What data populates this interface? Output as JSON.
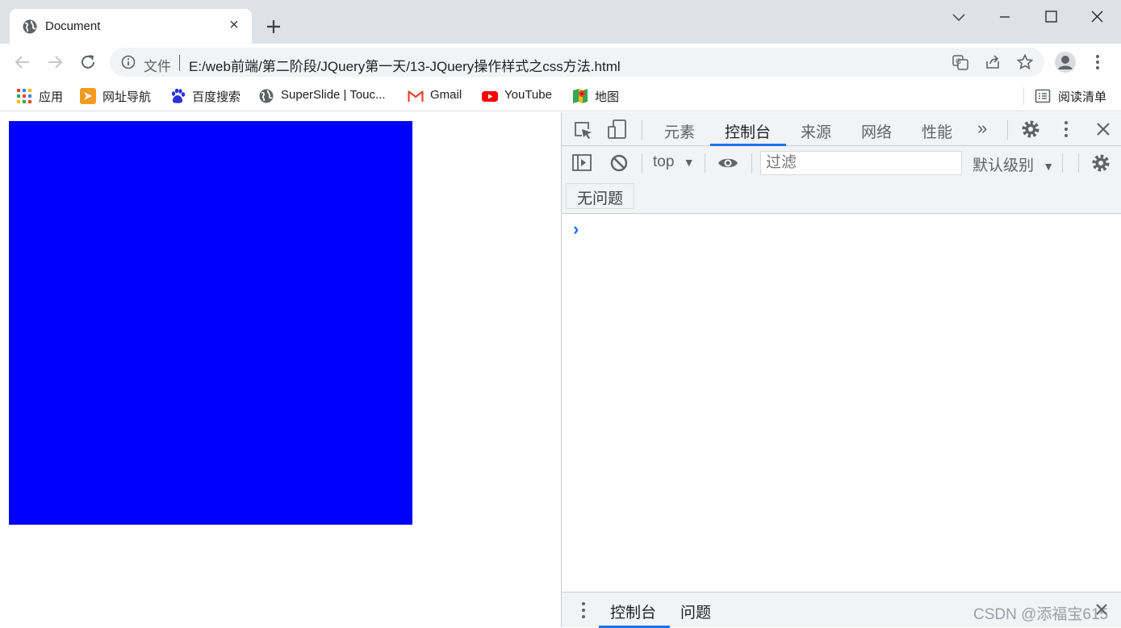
{
  "browser": {
    "tab": {
      "title": "Document"
    },
    "address_bar": {
      "security_label": "文件",
      "url": "E:/web前端/第二阶段/JQuery第一天/13-JQuery操作样式之css方法.html"
    },
    "bookmarks": [
      {
        "label": "应用",
        "icon": "apps-grid-icon"
      },
      {
        "label": "网址导航",
        "icon": "nav-arrow-icon"
      },
      {
        "label": "百度搜索",
        "icon": "baidu-paw-icon"
      },
      {
        "label": "SuperSlide | Touc...",
        "icon": "globe-icon"
      },
      {
        "label": "Gmail",
        "icon": "gmail-icon"
      },
      {
        "label": "YouTube",
        "icon": "youtube-icon"
      },
      {
        "label": "地图",
        "icon": "maps-icon"
      }
    ],
    "reading_list": {
      "label": "阅读清单"
    }
  },
  "page": {
    "box_color": "#0000ff"
  },
  "devtools": {
    "tabs": [
      {
        "label": "元素"
      },
      {
        "label": "控制台"
      },
      {
        "label": "来源"
      },
      {
        "label": "网络"
      },
      {
        "label": "性能"
      }
    ],
    "active_tab": "控制台",
    "more_tabs": "»",
    "console": {
      "context": "top",
      "filter_placeholder": "过滤",
      "level": "默认级别",
      "issues_button": "无问题",
      "prompt": "›"
    },
    "drawer": {
      "tabs": [
        {
          "label": "控制台"
        },
        {
          "label": "问题"
        }
      ],
      "watermark": "CSDN @添福宝615"
    }
  },
  "colors": {
    "accent": "#1a73e8",
    "tabstrip_bg": "#dee1e6",
    "devtools_bg": "#f1f3f4"
  }
}
